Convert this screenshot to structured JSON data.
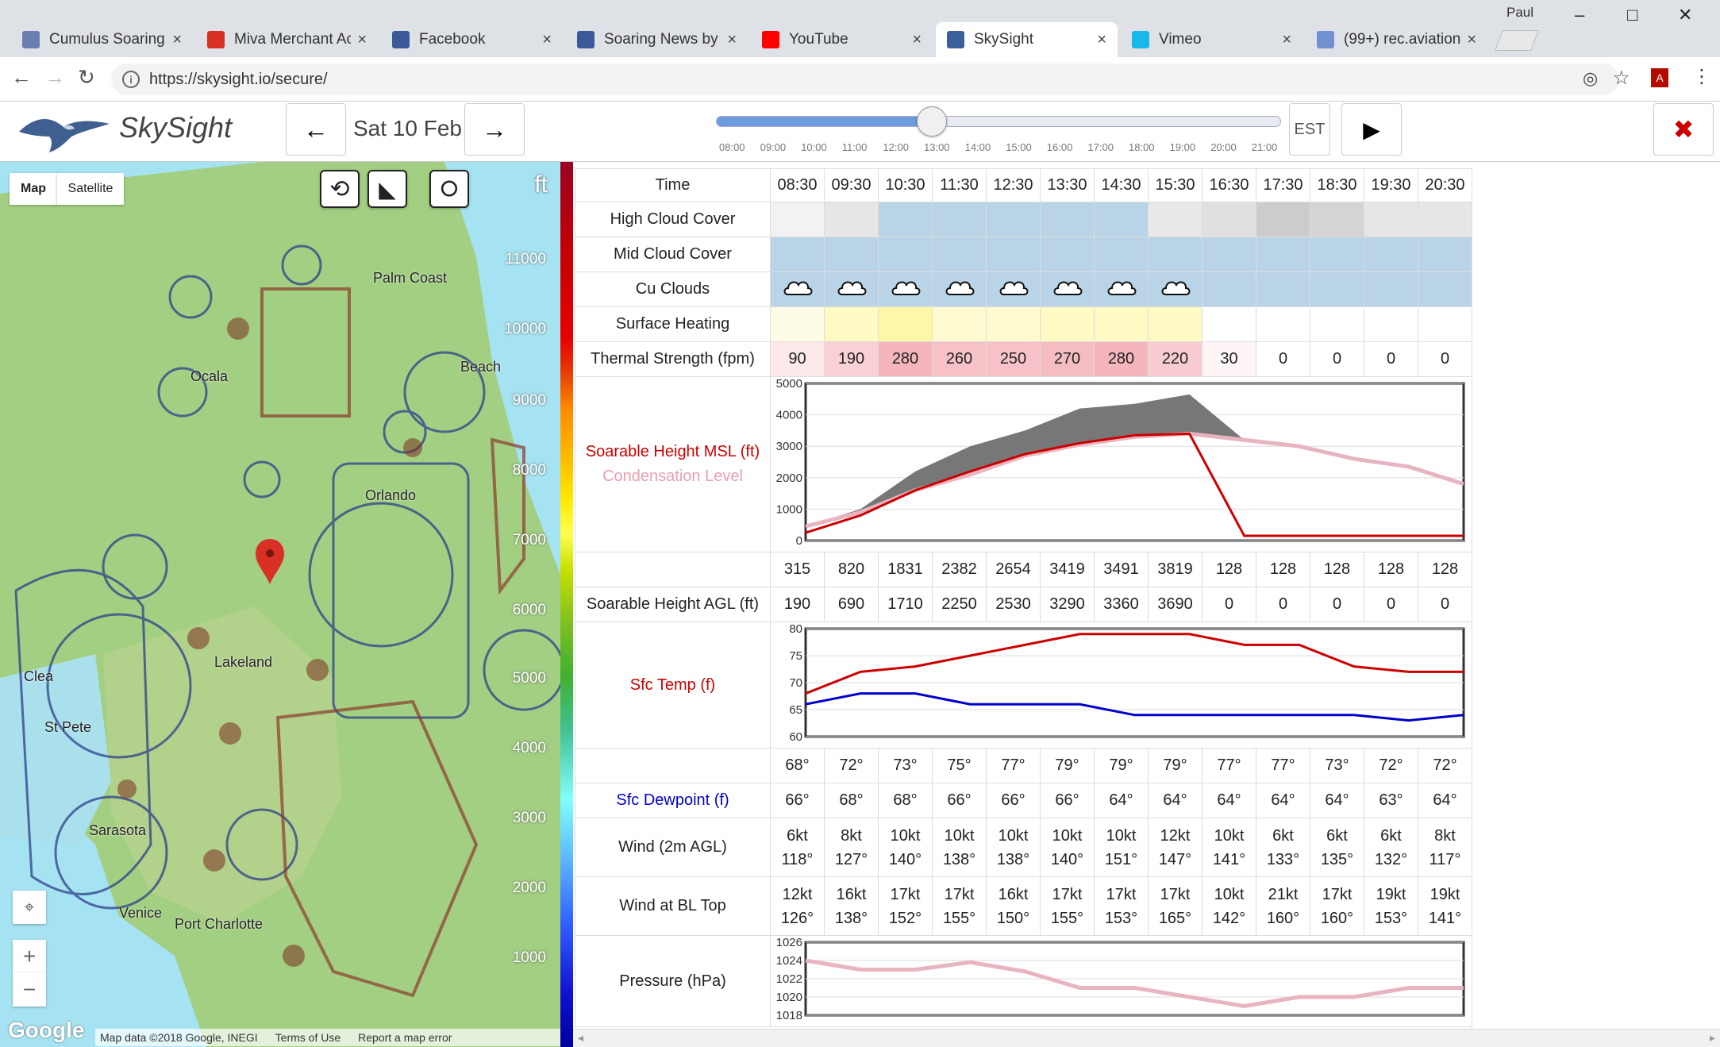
{
  "browser": {
    "user": "Paul",
    "tabs": [
      {
        "label": "Cumulus Soaring",
        "icon": "feather-icon",
        "color": "#6a7fb0"
      },
      {
        "label": "Miva Merchant Ac",
        "icon": "gmail-icon",
        "color": "#d93025"
      },
      {
        "label": "Facebook",
        "icon": "facebook-icon",
        "color": "#3b5998"
      },
      {
        "label": "Soaring News by",
        "icon": "facebook-icon",
        "color": "#3b5998"
      },
      {
        "label": "YouTube",
        "icon": "youtube-icon",
        "color": "#ff0000"
      },
      {
        "label": "SkySight",
        "icon": "skysight-icon",
        "color": "#3a5f9a"
      },
      {
        "label": "Vimeo",
        "icon": "vimeo-icon",
        "color": "#1ab7ea"
      },
      {
        "label": "(99+) rec.aviation",
        "icon": "groups-icon",
        "color": "#7090d0"
      }
    ],
    "url": "https://skysight.io/secure/"
  },
  "app": {
    "brand": "SkySight",
    "date": "Sat 10 Feb",
    "timezone": "EST",
    "slider_ticks": [
      "08:00",
      "09:00",
      "10:00",
      "11:00",
      "12:00",
      "13:00",
      "14:00",
      "15:00",
      "16:00",
      "17:00",
      "18:00",
      "19:00",
      "20:00",
      "21:00"
    ],
    "slider_position": 0.38
  },
  "map": {
    "map_label": "Map",
    "satellite_label": "Satellite",
    "unit": "ft",
    "altitudes": [
      "11000",
      "10000",
      "9000",
      "8000",
      "7000",
      "6000",
      "5000",
      "4000",
      "3000",
      "2000",
      "1000"
    ],
    "places": [
      "Palm Coast",
      "Beach",
      "Clea",
      "St Pete",
      "Sarasota",
      "Venice",
      "Port Charlotte",
      "Lakeland",
      "Orlando",
      "Ocala"
    ],
    "attribution": "Map data ©2018 Google, INEGI",
    "terms": "Terms of Use",
    "report": "Report a map error",
    "google": "Google"
  },
  "forecast": {
    "time_label": "Time",
    "times": [
      "08:30",
      "09:30",
      "10:30",
      "11:30",
      "12:30",
      "13:30",
      "14:30",
      "15:30",
      "16:30",
      "17:30",
      "18:30",
      "19:30",
      "20:30"
    ],
    "rows": {
      "high_cloud": "High Cloud Cover",
      "mid_cloud": "Mid Cloud Cover",
      "cu_clouds": "Cu Clouds",
      "surface_heating": "Surface Heating",
      "thermal_strength": "Thermal Strength (fpm)",
      "soarable_msl": "Soarable Height MSL (ft)",
      "condensation": "Condensation Level",
      "soarable_agl": "Soarable Height AGL (ft)",
      "sfc_temp": "Sfc Temp (f)",
      "sfc_dewpoint": "Sfc Dewpoint (f)",
      "wind_2m": "Wind (2m AGL)",
      "wind_bl": "Wind at BL Top",
      "pressure": "Pressure (hPa)"
    },
    "high_cloud_colors": [
      "#f2f2f2",
      "#e6e6e6",
      "#b8d4e6",
      "#b8d4e6",
      "#b8d4e6",
      "#b8d4e6",
      "#b8d4e6",
      "#e8e8e8",
      "#e0e0e0",
      "#cccccc",
      "#d4d4d4",
      "#e6e6e6",
      "#e6e6e6"
    ],
    "cu_clouds_present": [
      true,
      true,
      true,
      true,
      true,
      true,
      true,
      true,
      false,
      false,
      false,
      false,
      false
    ],
    "heating_colors": [
      "#fffce6",
      "#fff9c4",
      "#fff7a8",
      "#fffad0",
      "#fffad0",
      "#fff9c4",
      "#fff9c4",
      "#fff9c4",
      "#ffffff",
      "#ffffff",
      "#ffffff",
      "#ffffff",
      "#ffffff"
    ],
    "thermal": [
      "90",
      "190",
      "280",
      "260",
      "250",
      "270",
      "280",
      "220",
      "30",
      "0",
      "0",
      "0",
      "0"
    ],
    "thermal_colors": [
      "#fde8ea",
      "#f9d0d4",
      "#f4b6bc",
      "#f6c2c7",
      "#f6c2c7",
      "#f5bcc1",
      "#f4b6bc",
      "#f8ccd0",
      "#fdf4f5",
      "#ffffff",
      "#ffffff",
      "#ffffff",
      "#ffffff"
    ],
    "msl_values": [
      "315",
      "820",
      "1831",
      "2382",
      "2654",
      "3419",
      "3491",
      "3819",
      "128",
      "128",
      "128",
      "128",
      "128"
    ],
    "agl_values": [
      "190",
      "690",
      "1710",
      "2250",
      "2530",
      "3290",
      "3360",
      "3690",
      "0",
      "0",
      "0",
      "0",
      "0"
    ],
    "temp_values": [
      "68°",
      "72°",
      "73°",
      "75°",
      "77°",
      "79°",
      "79°",
      "79°",
      "77°",
      "77°",
      "73°",
      "72°",
      "72°"
    ],
    "dew_values": [
      "66°",
      "68°",
      "68°",
      "66°",
      "66°",
      "66°",
      "64°",
      "64°",
      "64°",
      "64°",
      "64°",
      "63°",
      "64°"
    ],
    "wind2m": [
      [
        "6kt",
        "118°"
      ],
      [
        "8kt",
        "127°"
      ],
      [
        "10kt",
        "140°"
      ],
      [
        "10kt",
        "138°"
      ],
      [
        "10kt",
        "138°"
      ],
      [
        "10kt",
        "140°"
      ],
      [
        "10kt",
        "151°"
      ],
      [
        "12kt",
        "147°"
      ],
      [
        "10kt",
        "141°"
      ],
      [
        "6kt",
        "133°"
      ],
      [
        "6kt",
        "135°"
      ],
      [
        "6kt",
        "132°"
      ],
      [
        "8kt",
        "117°"
      ]
    ],
    "windbl": [
      [
        "12kt",
        "126°"
      ],
      [
        "16kt",
        "138°"
      ],
      [
        "17kt",
        "152°"
      ],
      [
        "17kt",
        "155°"
      ],
      [
        "16kt",
        "150°"
      ],
      [
        "17kt",
        "155°"
      ],
      [
        "17kt",
        "153°"
      ],
      [
        "17kt",
        "165°"
      ],
      [
        "10kt",
        "142°"
      ],
      [
        "21kt",
        "160°"
      ],
      [
        "17kt",
        "160°"
      ],
      [
        "19kt",
        "153°"
      ],
      [
        "19kt",
        "141°"
      ]
    ]
  },
  "chart_data": [
    {
      "type": "area",
      "ylim": [
        0,
        5000
      ],
      "yticks": [
        "5000",
        "4000",
        "3000",
        "2000",
        "1000",
        "0"
      ],
      "series": [
        {
          "name": "Soarable Height MSL (ft)",
          "color": "#cc0000",
          "values": [
            250,
            800,
            1600,
            2200,
            2750,
            3100,
            3350,
            3400,
            150,
            150,
            150,
            150,
            150
          ]
        },
        {
          "name": "Condensation Level",
          "color": "#e8b4c0",
          "values": [
            450,
            900,
            1600,
            2100,
            2700,
            3050,
            3300,
            3400,
            3200,
            3000,
            2600,
            2350,
            1800
          ]
        },
        {
          "name": "cloud",
          "color": "#777777",
          "values": [
            450,
            1000,
            2200,
            3000,
            3500,
            4200,
            4350,
            4650,
            3200,
            3000,
            2600,
            2350,
            1800
          ]
        }
      ]
    },
    {
      "type": "line",
      "ylim": [
        60,
        80
      ],
      "yticks": [
        "80",
        "75",
        "70",
        "65",
        "60"
      ],
      "series": [
        {
          "name": "Sfc Temp (f)",
          "color": "#cc0000",
          "values": [
            68,
            72,
            73,
            75,
            77,
            79,
            79,
            79,
            77,
            77,
            73,
            72,
            72
          ]
        },
        {
          "name": "Sfc Dewpoint (f)",
          "color": "#0000cc",
          "values": [
            66,
            68,
            68,
            66,
            66,
            66,
            64,
            64,
            64,
            64,
            64,
            63,
            64
          ]
        }
      ]
    },
    {
      "type": "line",
      "ylim": [
        1018,
        1026
      ],
      "yticks": [
        "1026",
        "1024",
        "1022",
        "1020",
        "1018"
      ],
      "series": [
        {
          "name": "Pressure (hPa)",
          "color": "#e8b4c0",
          "values": [
            1024,
            1023,
            1023,
            1023.8,
            1022.8,
            1021,
            1021,
            1020,
            1019,
            1020,
            1020,
            1021,
            1021
          ]
        }
      ]
    }
  ]
}
